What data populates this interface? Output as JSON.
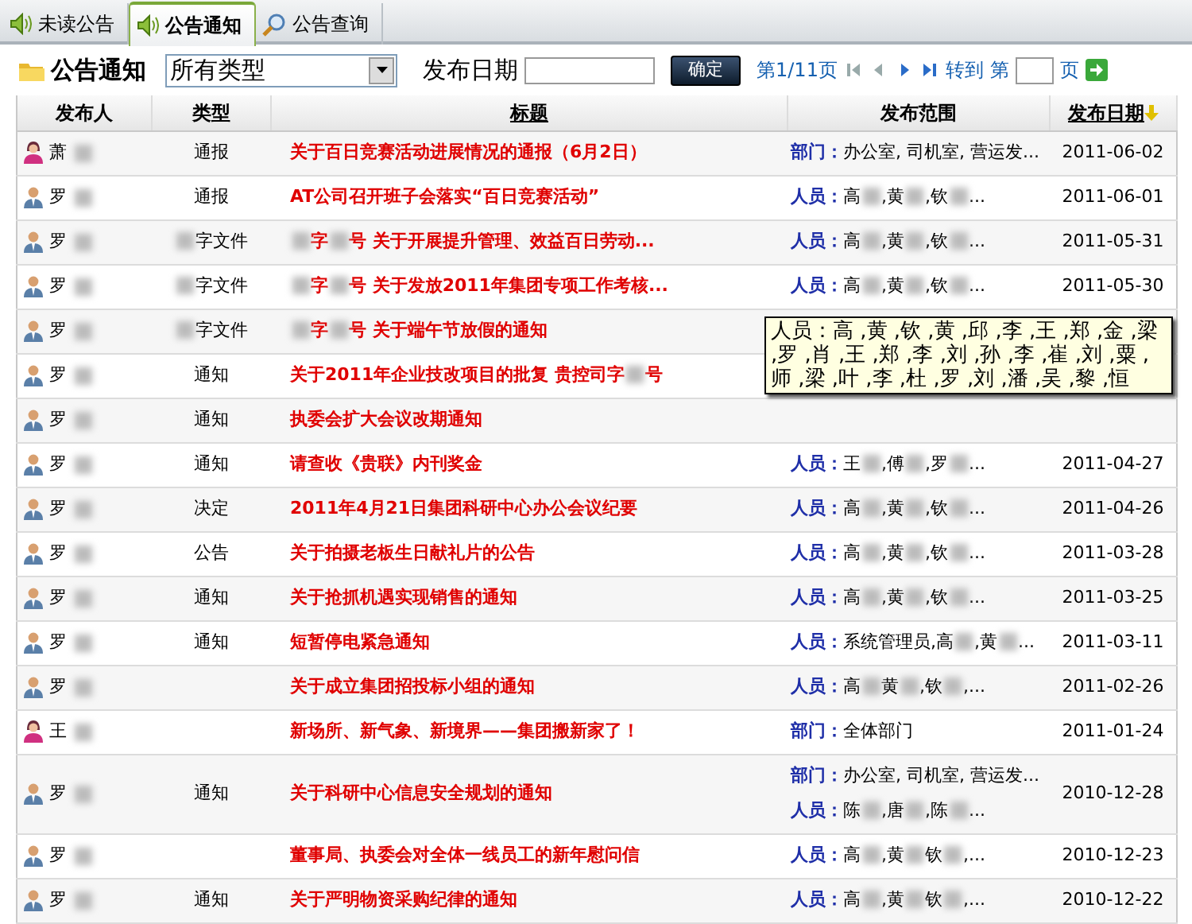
{
  "tabs": [
    {
      "label": "未读公告",
      "selected": false
    },
    {
      "label": "公告通知",
      "selected": true
    },
    {
      "label": "公告查询",
      "selected": false
    }
  ],
  "toolbar": {
    "title": "公告通知",
    "type_select": "所有类型",
    "date_label": "发布日期",
    "confirm_button": "确定",
    "page_info": "第1/11页",
    "goto_label": "转到",
    "goto_prefix": "第",
    "goto_suffix": "页"
  },
  "table": {
    "columns": [
      {
        "label": "发布人",
        "sortable": false
      },
      {
        "label": "类型",
        "sortable": false
      },
      {
        "label": "标题",
        "sortable": true
      },
      {
        "label": "发布范围",
        "sortable": false
      },
      {
        "label": "发布日期",
        "sortable": true,
        "sorted": true
      }
    ],
    "rows": [
      {
        "kind": "female",
        "publisher": "萧",
        "type": "通报",
        "title": [
          "关于百日竞赛活动进展情况的通报（6月2日）"
        ],
        "scope": [
          {
            "label": "部门：",
            "text": "办公室, 司机室, 营运发..."
          }
        ],
        "date": "2011-06-02"
      },
      {
        "kind": "male",
        "publisher": "罗",
        "type": "通报",
        "title": [
          "AT公司召开班子会落实“百日竞赛活动”"
        ],
        "scope": [
          {
            "label": "人员：",
            "names": [
              "高",
              ",黄",
              ",钦"
            ],
            "tail": "..."
          }
        ],
        "date": "2011-06-01"
      },
      {
        "kind": "male",
        "publisher": "罗",
        "type": "字文件",
        "type_redacted": true,
        "title_redacted_lead": true,
        "title": [
          "字",
          "号 关于开展提升管理、效益百日劳动..."
        ],
        "scope": [
          {
            "label": "人员：",
            "names": [
              "高",
              ",黄",
              ",钦"
            ],
            "tail": "..."
          }
        ],
        "date": "2011-05-31"
      },
      {
        "kind": "male",
        "publisher": "罗",
        "type": "字文件",
        "type_redacted": true,
        "title_redacted_lead": true,
        "title": [
          "字",
          "号 关于发放2011年集团专项工作考核..."
        ],
        "scope": [
          {
            "label": "人员：",
            "names": [
              "高",
              ",黄",
              ",钦"
            ],
            "tail": "..."
          }
        ],
        "date": "2011-05-30"
      },
      {
        "kind": "male",
        "publisher": "罗",
        "type": "字文件",
        "type_redacted": true,
        "title_redacted_lead": true,
        "title": [
          "字",
          "号 关于端午节放假的通知"
        ]
      },
      {
        "kind": "male",
        "publisher": "罗",
        "type": "通知",
        "title": [
          "关于2011年企业技改项目的批复 贵控司字",
          "号"
        ]
      },
      {
        "kind": "male",
        "publisher": "罗",
        "type": "通知",
        "title": [
          "执委会扩大会议改期通知"
        ]
      },
      {
        "kind": "male",
        "publisher": "罗",
        "type": "通知",
        "title": [
          "请查收《贵联》内刊奖金"
        ],
        "scope": [
          {
            "label": "人员：",
            "names": [
              "王",
              ",傅",
              ",罗"
            ],
            "tail": "..."
          }
        ],
        "date": "2011-04-27"
      },
      {
        "kind": "male",
        "publisher": "罗",
        "type": "决定",
        "title": [
          "2011年4月21日集团科研中心办公会议纪要"
        ],
        "scope": [
          {
            "label": "人员：",
            "names": [
              "高",
              ",黄",
              ",钦"
            ],
            "tail": "..."
          }
        ],
        "date": "2011-04-26"
      },
      {
        "kind": "male",
        "publisher": "罗",
        "type": "公告",
        "title": [
          "关于拍摄老板生日献礼片的公告"
        ],
        "scope": [
          {
            "label": "人员：",
            "names": [
              "高",
              ",黄",
              ",钦"
            ],
            "tail": "..."
          }
        ],
        "date": "2011-03-28"
      },
      {
        "kind": "male",
        "publisher": "罗",
        "type": "通知",
        "title": [
          "关于抢抓机遇实现销售的通知"
        ],
        "scope": [
          {
            "label": "人员：",
            "names": [
              "高",
              ",黄",
              ",钦"
            ],
            "tail": "..."
          }
        ],
        "date": "2011-03-25"
      },
      {
        "kind": "male",
        "publisher": "罗",
        "type": "通知",
        "title": [
          "短暂停电紧急通知"
        ],
        "scope": [
          {
            "label": "人员：",
            "names": [
              "系统管理员,高",
              ",黄"
            ],
            "tail": "..."
          }
        ],
        "date": "2011-03-11"
      },
      {
        "kind": "male",
        "publisher": "罗",
        "title": [
          "关于成立集团招投标小组的通知"
        ],
        "scope": [
          {
            "label": "人员：",
            "names": [
              "高",
              "黄",
              ",钦"
            ],
            "tail": ",..."
          }
        ],
        "date": "2011-02-26"
      },
      {
        "kind": "female",
        "publisher": "王",
        "title": [
          "新场所、新气象、新境界——集团搬新家了！"
        ],
        "scope": [
          {
            "label": "部门：",
            "text": "全体部门"
          }
        ],
        "date": "2011-01-24"
      },
      {
        "kind": "male",
        "publisher": "罗",
        "type": "通知",
        "title": [
          "关于科研中心信息安全规划的通知"
        ],
        "scope": [
          {
            "label": "部门：",
            "text": "办公室, 司机室, 营运发..."
          },
          {
            "label": "人员：",
            "names": [
              "陈",
              ",唐",
              ",陈"
            ],
            "tail": "..."
          }
        ],
        "date": "2010-12-28"
      },
      {
        "kind": "male",
        "publisher": "罗",
        "title": [
          "董事局、执委会对全体一线员工的新年慰问信"
        ],
        "scope": [
          {
            "label": "人员：",
            "names": [
              "高",
              ",黄",
              "钦"
            ],
            "tail": ",..."
          }
        ],
        "date": "2010-12-23"
      },
      {
        "kind": "male",
        "publisher": "罗",
        "type": "通知",
        "title": [
          "关于严明物资采购纪律的通知"
        ],
        "scope": [
          {
            "label": "人员：",
            "names": [
              "高",
              ",黄",
              "钦"
            ],
            "tail": ",..."
          }
        ],
        "date": "2010-12-22"
      }
    ]
  },
  "tooltip": {
    "text": "人员：高 ,黄 ,钦 ,黄 ,邱 ,李 ,王 ,郑 ,金 ,梁 ,罗 ,肖 ,王 ,郑 ,李 ,刘 ,孙 ,李 ,崔 ,刘 ,粟 ,师 ,梁 ,叶 ,李 ,杜 ,罗 ,刘 ,潘 ,吴 ,黎 ,恒"
  }
}
